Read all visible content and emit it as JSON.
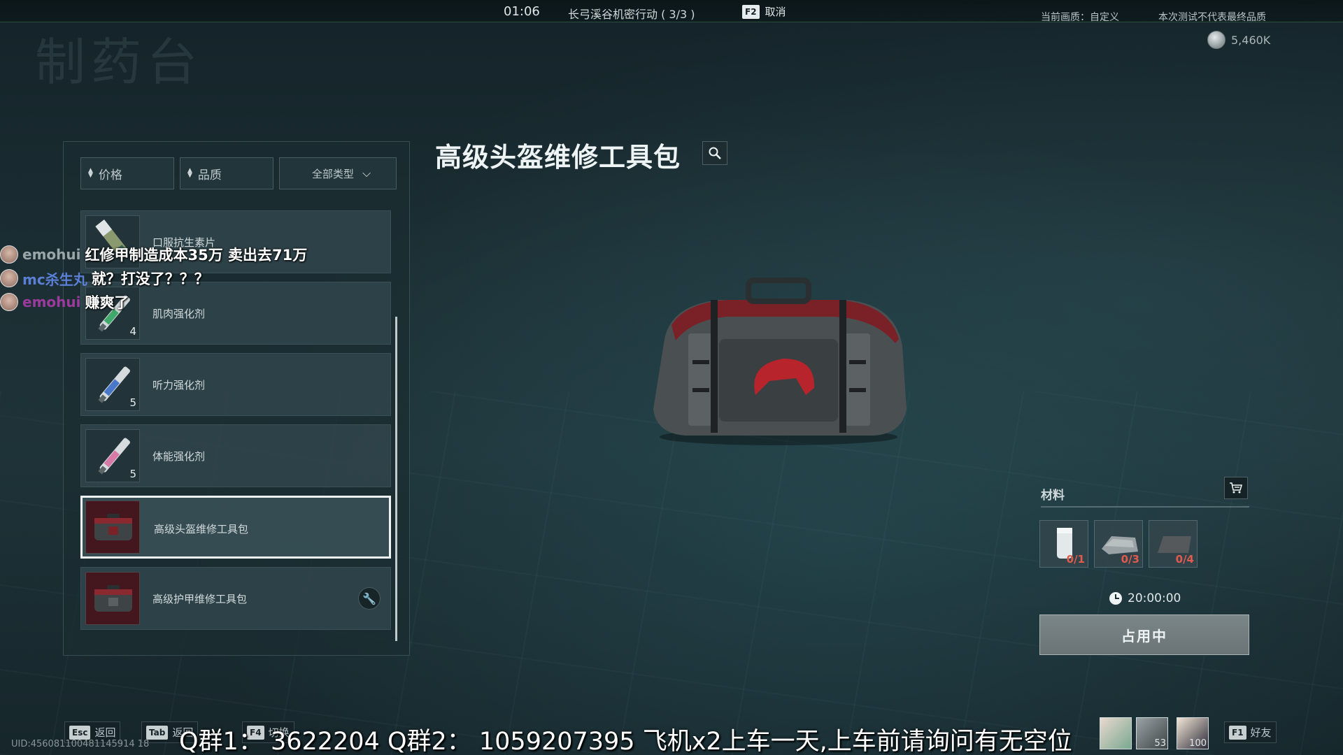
{
  "top_bar": {
    "timer": "01:06",
    "mission": "长弓溪谷机密行动 ( 3/3 )",
    "cancel_key": "F2",
    "cancel_label": "取消",
    "quality": "当前画质：自定义",
    "disclaimer": "本次测试不代表最终品质",
    "currency": "5,460K"
  },
  "page_title": "制药台",
  "filters": {
    "price": "价格",
    "quality": "品质",
    "type": "全部类型"
  },
  "items": [
    {
      "name": "口服抗生素片",
      "count": ""
    },
    {
      "name": "肌肉强化剂",
      "count": "4"
    },
    {
      "name": "听力强化剂",
      "count": "5"
    },
    {
      "name": "体能强化剂",
      "count": "5"
    },
    {
      "name": "高级头盔维修工具包",
      "count": "",
      "selected": true
    },
    {
      "name": "高级护甲维修工具包",
      "count": "",
      "has_tool": true
    }
  ],
  "chat": [
    {
      "user": "emohui",
      "message": "红修甲制造成本35万 卖出去71万",
      "color": "#9aa6a8"
    },
    {
      "user": "mc杀生丸",
      "message": "就？打没了？？？",
      "color": "#5b7fd6"
    },
    {
      "user": "emohui",
      "message": "赚爽了",
      "color": "#9a3a9c"
    }
  ],
  "detail": {
    "title": "高级头盔维修工具包"
  },
  "materials": {
    "label": "材料",
    "items": [
      {
        "name": "white-canister",
        "count": "0/1"
      },
      {
        "name": "gray-cloth",
        "count": "0/3"
      },
      {
        "name": "dark-plate",
        "count": "0/4"
      }
    ],
    "timer": "20:00:00",
    "status_button": "占用中"
  },
  "bottom": {
    "esc_key": "Esc",
    "esc_label": "返回",
    "tab_key": "Tab",
    "tab_label": "返回",
    "f4_key": "F4",
    "f4_label": "切换",
    "uid": "UID:456081100481145914 18",
    "banner": "Q群1： 3622204    Q群2： 1059207395     飞机x2上车一天,上车前请询问有无空位",
    "friends_key": "F1",
    "friends_label": "好友",
    "avatar_count_1": "53",
    "avatar_count_2": "100"
  }
}
